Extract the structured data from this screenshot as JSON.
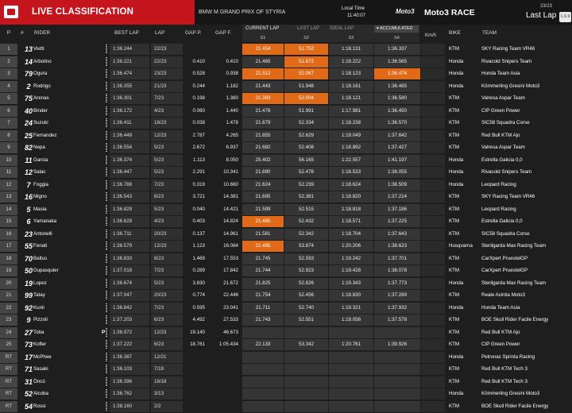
{
  "header": {
    "title": "LIVE CLASSIFICATION",
    "event": "BMW M GRAND PRIX OF STYRIA",
    "local_time_label": "Local Time",
    "local_time": "11:40:07",
    "class_logo": "Moto3",
    "race_label": "Moto3 RACE",
    "laps": "23/23",
    "last_lap": "Last Lap",
    "version": "1.6.9"
  },
  "columns": {
    "pos": "P",
    "num": "#",
    "rider": "RIDER",
    "best_lap": "BEST LAP",
    "lap": "LAP",
    "gap_p": "GAP P.",
    "gap_f": "GAP F.",
    "current_lap": "CURRENT LAP",
    "last_lap": "LAST LAP",
    "ideal_lap": "IDEAL LAP",
    "accumulated": "ACCUMULATED",
    "s1": "S1",
    "s2": "S2",
    "s3": "S3",
    "s4": "S4",
    "kmh": "Km/h",
    "bike": "BIKE",
    "team": "TEAM"
  },
  "rows": [
    {
      "pos": "1",
      "num": "13",
      "rider": "Vietti",
      "best": "1:36.244",
      "lap": "22/23",
      "gp": "",
      "gf": "",
      "s1": "21.454",
      "s2": "51.752",
      "s3": "1:18.131",
      "s4": "1:36.337",
      "bike": "KTM",
      "team": "SKY Racing Team VR46",
      "h1": true,
      "h2": true
    },
    {
      "pos": "2",
      "num": "14",
      "rider": "Arbolino",
      "best": "1:36.221",
      "lap": "22/23",
      "gp": "0.410",
      "gf": "0.410",
      "s1": "21.465",
      "s2": "51.872",
      "s3": "1:18.222",
      "s4": "1:36.565",
      "bike": "Honda",
      "team": "Rivacold Snipers Team",
      "h2": true
    },
    {
      "pos": "3",
      "num": "79",
      "rider": "Ogura",
      "best": "1:36.474",
      "lap": "23/23",
      "gp": "0.528",
      "gf": "0.938",
      "s1": "21.512",
      "s2": "52.067",
      "s3": "1:18.123",
      "s4": "1:36.474",
      "bike": "Honda",
      "team": "Honda Team Asia",
      "h1": true,
      "h2": true,
      "h4": true
    },
    {
      "pos": "4",
      "num": "2",
      "rider": "Rodrigo",
      "best": "1:36.355",
      "lap": "21/23",
      "gp": "0.244",
      "gf": "1.182",
      "s1": "21.443",
      "s2": "51.948",
      "s3": "1:18.161",
      "s4": "1:36.485",
      "bike": "Honda",
      "team": "Kömmerling Gresini Moto3"
    },
    {
      "pos": "5",
      "num": "75",
      "rider": "Arenas",
      "best": "1:36.301",
      "lap": "7/23",
      "gp": "0.198",
      "gf": "1.380",
      "s1": "21.383",
      "s2": "52.004",
      "s3": "1:18.121",
      "s4": "1:36.580",
      "bike": "KTM",
      "team": "Valresa Aspar Team",
      "h1": true,
      "h2": true
    },
    {
      "pos": "6",
      "num": "40",
      "rider": "Binder",
      "best": "1:36.172",
      "lap": "4/23",
      "gp": "0.060",
      "gf": "1.440",
      "s1": "21.478",
      "s2": "51.991",
      "s3": "1:17.981",
      "s4": "1:36.450",
      "bike": "KTM",
      "team": "CIP Green Power"
    },
    {
      "pos": "7",
      "num": "24",
      "rider": "Suzuki",
      "best": "1:36.411",
      "lap": "18/23",
      "gp": "0.038",
      "gf": "1.478",
      "s1": "21.679",
      "s2": "52.334",
      "s3": "1:18.238",
      "s4": "1:36.570",
      "bike": "KTM",
      "team": "SIC58 Squadra Corse"
    },
    {
      "pos": "8",
      "num": "25",
      "rider": "Fernandez",
      "best": "1:36.449",
      "lap": "12/23",
      "gp": "2.787",
      "gf": "4.265",
      "s1": "21.855",
      "s2": "52.629",
      "s3": "1:19.049",
      "s4": "1:37.642",
      "bike": "KTM",
      "team": "Red Bull KTM Ajo"
    },
    {
      "pos": "9",
      "num": "82",
      "rider": "Nepa",
      "best": "1:36.554",
      "lap": "5/23",
      "gp": "2.672",
      "gf": "6.937",
      "s1": "21.682",
      "s2": "52.408",
      "s3": "1:18.892",
      "s4": "1:37.427",
      "bike": "KTM",
      "team": "Valresa Aspar Team"
    },
    {
      "pos": "10",
      "num": "11",
      "rider": "Garcia",
      "best": "1:36.374",
      "lap": "5/23",
      "gp": "1.113",
      "gf": "8.050",
      "s1": "25.402",
      "s2": "56.165",
      "s3": "1:22.557",
      "s4": "1:41.197",
      "bike": "Honda",
      "team": "Estrella Galicia 0,0"
    },
    {
      "pos": "11",
      "num": "12",
      "rider": "Salac",
      "best": "1:36.447",
      "lap": "5/23",
      "gp": "2.291",
      "gf": "10.341",
      "s1": "21.690",
      "s2": "52.478",
      "s3": "1:18.533",
      "s4": "1:38.055",
      "bike": "Honda",
      "team": "Rivacold Snipers Team"
    },
    {
      "pos": "12",
      "num": "7",
      "rider": "Foggia",
      "best": "1:36.788",
      "lap": "7/23",
      "gp": "0.319",
      "gf": "10.660",
      "s1": "21.624",
      "s2": "52.239",
      "s3": "1:18.624",
      "s4": "1:38.509",
      "bike": "Honda",
      "team": "Leopard Racing"
    },
    {
      "pos": "13",
      "num": "16",
      "rider": "Migno",
      "best": "1:36.543",
      "lap": "6/23",
      "gp": "3.721",
      "gf": "14.381",
      "s1": "21.695",
      "s2": "52.381",
      "s3": "1:18.820",
      "s4": "1:37.214",
      "bike": "KTM",
      "team": "SKY Racing Team VR46"
    },
    {
      "pos": "14",
      "num": "5",
      "rider": "Masia",
      "best": "1:36.829",
      "lap": "5/23",
      "gp": "0.040",
      "gf": "14.421",
      "s1": "21.599",
      "s2": "52.515",
      "s3": "1:18.818",
      "s4": "1:37.186",
      "bike": "KTM",
      "team": "Leopard Racing"
    },
    {
      "pos": "15",
      "num": "6",
      "rider": "Yamanaka",
      "best": "1:36.628",
      "lap": "4/23",
      "gp": "0.403",
      "gf": "14.824",
      "s1": "21.485",
      "s2": "52.432",
      "s3": "1:18.571",
      "s4": "1:37.225",
      "bike": "KTM",
      "team": "Estrella Galicia 0,0",
      "h1": true
    },
    {
      "pos": "16",
      "num": "23",
      "rider": "Antonelli",
      "best": "1:36.711",
      "lap": "20/23",
      "gp": "0.137",
      "gf": "14.961",
      "s1": "21.581",
      "s2": "52.342",
      "s3": "1:18.704",
      "s4": "1:37.643",
      "bike": "KTM",
      "team": "SIC58 Squadra Corse"
    },
    {
      "pos": "17",
      "num": "55",
      "rider": "Fenati",
      "best": "1:36.579",
      "lap": "12/23",
      "gp": "1.123",
      "gf": "16.084",
      "s1": "21.495",
      "s2": "53.874",
      "s3": "1:20.206",
      "s4": "1:38.623",
      "bike": "Husqvarna",
      "team": "Sterilgarda Max Racing Team",
      "h1": true
    },
    {
      "pos": "18",
      "num": "70",
      "rider": "Baltus",
      "best": "1:36.833",
      "lap": "8/23",
      "gp": "1.469",
      "gf": "17.553",
      "s1": "21.745",
      "s2": "52.593",
      "s3": "1:19.242",
      "s4": "1:37.701",
      "bike": "KTM",
      "team": "CarXpert PruestelGP"
    },
    {
      "pos": "19",
      "num": "50",
      "rider": "Dupasquier",
      "best": "1:37.018",
      "lap": "7/23",
      "gp": "0.289",
      "gf": "17.842",
      "s1": "21.744",
      "s2": "52.923",
      "s3": "1:19.428",
      "s4": "1:38.078",
      "bike": "KTM",
      "team": "CarXpert PruestelGP"
    },
    {
      "pos": "20",
      "num": "19",
      "rider": "Lopez",
      "best": "1:36.674",
      "lap": "5/23",
      "gp": "3.830",
      "gf": "21.672",
      "s1": "21.825",
      "s2": "52.826",
      "s3": "1:19.343",
      "s4": "1:37.773",
      "bike": "Honda",
      "team": "Sterilgarda Max Racing Team"
    },
    {
      "pos": "21",
      "num": "99",
      "rider": "Tatay",
      "best": "1:37.047",
      "lap": "20/23",
      "gp": "0.774",
      "gf": "22.446",
      "s1": "21.754",
      "s2": "52.456",
      "s3": "1:18.830",
      "s4": "1:37.289",
      "bike": "KTM",
      "team": "Reale Avintia Moto3"
    },
    {
      "pos": "22",
      "num": "92",
      "rider": "Kunii",
      "best": "1:36.842",
      "lap": "7/23",
      "gp": "0.595",
      "gf": "23.041",
      "s1": "21.711",
      "s2": "52.740",
      "s3": "1:19.321",
      "s4": "1:37.932",
      "bike": "Honda",
      "team": "Honda Team Asia"
    },
    {
      "pos": "23",
      "num": "9",
      "rider": "Pizzoli",
      "best": "1:37.203",
      "lap": "6/23",
      "gp": "4.492",
      "gf": "27.533",
      "s1": "21.743",
      "s2": "52.551",
      "s3": "1:19.056",
      "s4": "1:37.578",
      "bike": "KTM",
      "team": "BOE Skull Rider Facile Energy"
    },
    {
      "pos": "24",
      "num": "27",
      "rider": "Toba",
      "best": "1:36.972",
      "lap": "12/23",
      "gp": "19.140",
      "gf": "46.673",
      "s1": "",
      "s2": "",
      "s3": "",
      "s4": "",
      "bike": "KTM",
      "team": "Red Bull KTM Ajo",
      "pit": "P"
    },
    {
      "pos": "25",
      "num": "73",
      "rider": "Kofler",
      "best": "1:37.222",
      "lap": "6/23",
      "gp": "18.761",
      "gf": "1:05.434",
      "s1": "22.133",
      "s2": "53.342",
      "s3": "1:20.761",
      "s4": "1:39.926",
      "bike": "KTM",
      "team": "CIP Green Power"
    },
    {
      "pos": "RT",
      "num": "17",
      "rider": "McPhee",
      "best": "1:36.387",
      "lap": "12/21",
      "gp": "",
      "gf": "",
      "s1": "",
      "s2": "",
      "s3": "",
      "s4": "",
      "bike": "Honda",
      "team": "Petronas Sprinta Racing"
    },
    {
      "pos": "RT",
      "num": "71",
      "rider": "Sasaki",
      "best": "1:36.103",
      "lap": "7/18",
      "gp": "",
      "gf": "",
      "s1": "",
      "s2": "",
      "s3": "",
      "s4": "",
      "bike": "KTM",
      "team": "Red Bull KTM Tech 3"
    },
    {
      "pos": "RT",
      "num": "31",
      "rider": "Öncü",
      "best": "1:36.396",
      "lap": "18/18",
      "gp": "",
      "gf": "",
      "s1": "",
      "s2": "",
      "s3": "",
      "s4": "",
      "bike": "KTM",
      "team": "Red Bull KTM Tech 3"
    },
    {
      "pos": "RT",
      "num": "52",
      "rider": "Alcoba",
      "best": "1:36.762",
      "lap": "3/13",
      "gp": "",
      "gf": "",
      "s1": "",
      "s2": "",
      "s3": "",
      "s4": "",
      "bike": "Honda",
      "team": "Kömmerling Gresini Moto3"
    },
    {
      "pos": "RT",
      "num": "54",
      "rider": "Rossi",
      "best": "1:38.160",
      "lap": "2/2",
      "gp": "",
      "gf": "",
      "s1": "",
      "s2": "",
      "s3": "",
      "s4": "",
      "bike": "KTM",
      "team": "BOE Skull Rider Facile Energy"
    }
  ],
  "colors": {
    "header_red": "#c4141c",
    "highlight": "#e06a18"
  }
}
